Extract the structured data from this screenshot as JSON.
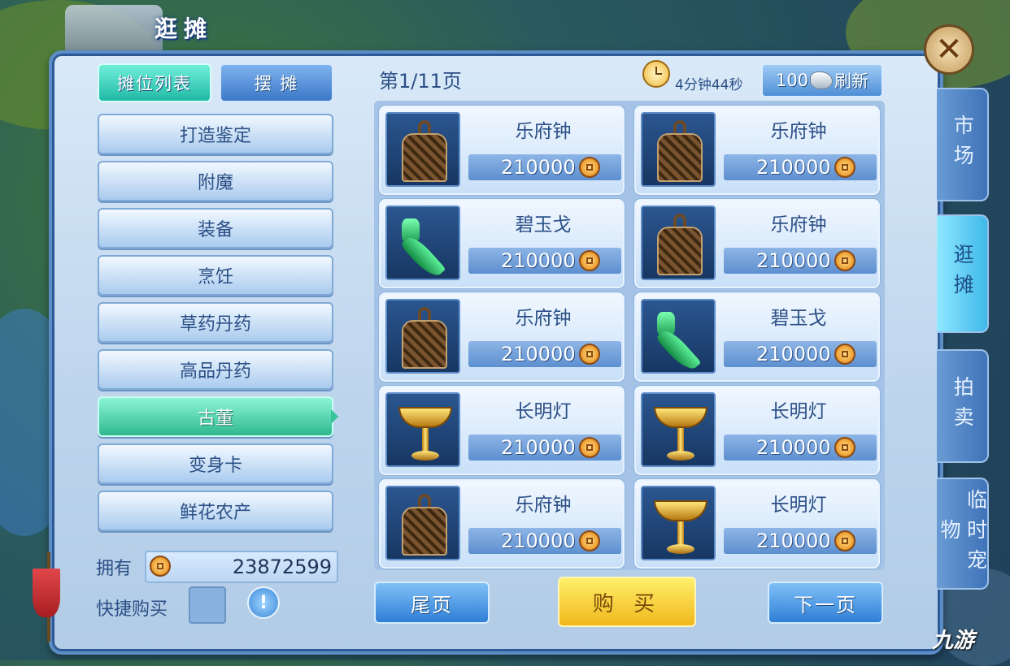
{
  "window": {
    "title": "逛摊"
  },
  "left_tabs": {
    "stall_list": "摊位列表",
    "set_stall": "摆 摊"
  },
  "categories": [
    "打造鉴定",
    "附魔",
    "装备",
    "烹饪",
    "草药丹药",
    "高品丹药",
    "古董",
    "变身卡",
    "鲜花农产"
  ],
  "active_category": "古董",
  "own": {
    "label": "拥有",
    "value": "23872599"
  },
  "quick_buy": {
    "label": "快捷购买"
  },
  "header": {
    "page": "第1/11页",
    "timer": "4分钟44秒",
    "refresh_cost": "100",
    "refresh_label": "刷新"
  },
  "items": [
    {
      "name": "乐府钟",
      "price": "210000",
      "icon": "bronze-bell-icon"
    },
    {
      "name": "乐府钟",
      "price": "210000",
      "icon": "bronze-bell-icon"
    },
    {
      "name": "碧玉戈",
      "price": "210000",
      "icon": "jade-dagger-axe-icon"
    },
    {
      "name": "乐府钟",
      "price": "210000",
      "icon": "bronze-bell-icon"
    },
    {
      "name": "乐府钟",
      "price": "210000",
      "icon": "bronze-bell-icon"
    },
    {
      "name": "碧玉戈",
      "price": "210000",
      "icon": "jade-dagger-axe-icon"
    },
    {
      "name": "长明灯",
      "price": "210000",
      "icon": "golden-lamp-icon"
    },
    {
      "name": "长明灯",
      "price": "210000",
      "icon": "golden-lamp-icon"
    },
    {
      "name": "乐府钟",
      "price": "210000",
      "icon": "bronze-bell-icon"
    },
    {
      "name": "长明灯",
      "price": "210000",
      "icon": "golden-lamp-icon"
    }
  ],
  "buttons": {
    "last_page": "尾页",
    "buy": "购 买",
    "next_page": "下一页"
  },
  "side_tabs": [
    "市场",
    "逛摊",
    "拍卖",
    "临时宠物"
  ],
  "active_side_tab": "逛摊",
  "watermark": "九游",
  "colors": {
    "active_tab": "#21b9a5",
    "buy_button": "#f0b81c",
    "panel_border": "#5d8dc6"
  }
}
